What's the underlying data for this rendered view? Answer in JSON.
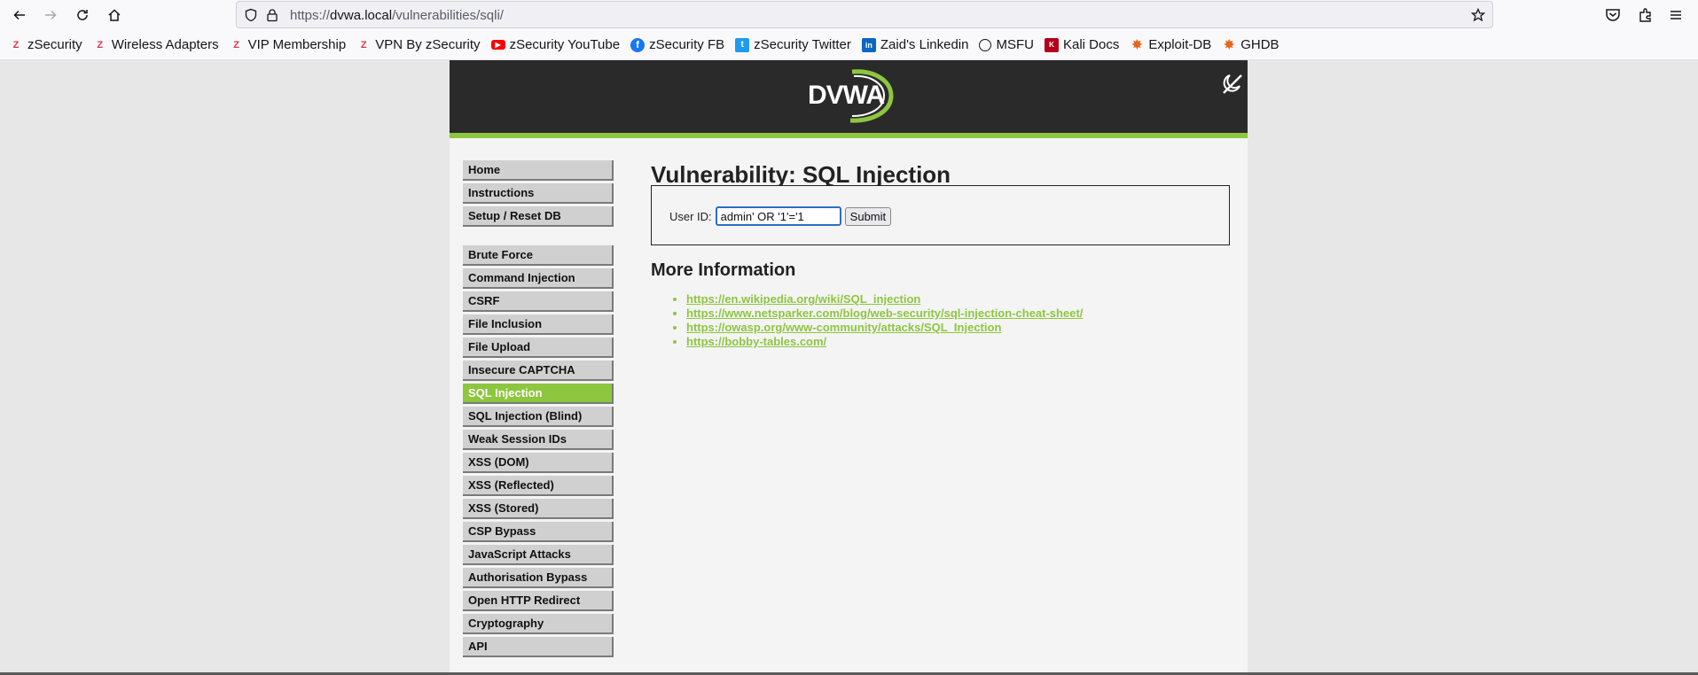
{
  "browser": {
    "url_prefix": "https://",
    "url_host": "dvwa.local",
    "url_path": "/vulnerabilities/sqli/"
  },
  "bookmarks": [
    {
      "label": "zSecurity",
      "icon": "zsecurity-icon"
    },
    {
      "label": "Wireless Adapters",
      "icon": "zsecurity-icon"
    },
    {
      "label": "VIP Membership",
      "icon": "zsecurity-icon"
    },
    {
      "label": "VPN By zSecurity",
      "icon": "zsecurity-icon"
    },
    {
      "label": "zSecurity YouTube",
      "icon": "youtube-icon"
    },
    {
      "label": "zSecurity FB",
      "icon": "facebook-icon"
    },
    {
      "label": "zSecurity Twitter",
      "icon": "twitter-icon"
    },
    {
      "label": "Zaid's Linkedin",
      "icon": "linkedin-icon"
    },
    {
      "label": "MSFU",
      "icon": "globe-icon"
    },
    {
      "label": "Kali Docs",
      "icon": "kali-docs-icon"
    },
    {
      "label": "Exploit-DB",
      "icon": "exploit-db-icon"
    },
    {
      "label": "GHDB",
      "icon": "ghdb-icon"
    }
  ],
  "dvwa": {
    "logo_text": "DVWA",
    "menu_top": [
      "Home",
      "Instructions",
      "Setup / Reset DB"
    ],
    "menu_vulns": [
      "Brute Force",
      "Command Injection",
      "CSRF",
      "File Inclusion",
      "File Upload",
      "Insecure CAPTCHA",
      "SQL Injection",
      "SQL Injection (Blind)",
      "Weak Session IDs",
      "XSS (DOM)",
      "XSS (Reflected)",
      "XSS (Stored)",
      "CSP Bypass",
      "JavaScript Attacks",
      "Authorisation Bypass",
      "Open HTTP Redirect",
      "Cryptography",
      "API"
    ],
    "selected_item": "SQL Injection",
    "page_title": "Vulnerability: SQL Injection",
    "form": {
      "label": "User ID:",
      "value": "admin' OR '1'='1",
      "submit_label": "Submit"
    },
    "more_info_title": "More Information",
    "links": [
      "https://en.wikipedia.org/wiki/SQL_injection",
      "https://www.netsparker.com/blog/web-security/sql-injection-cheat-sheet/",
      "https://owasp.org/www-community/attacks/SQL_Injection",
      "https://bobby-tables.com/"
    ]
  },
  "colors": {
    "accent": "#8dc63f",
    "header": "#2a2a2a",
    "menu": "#d0d0d0"
  }
}
